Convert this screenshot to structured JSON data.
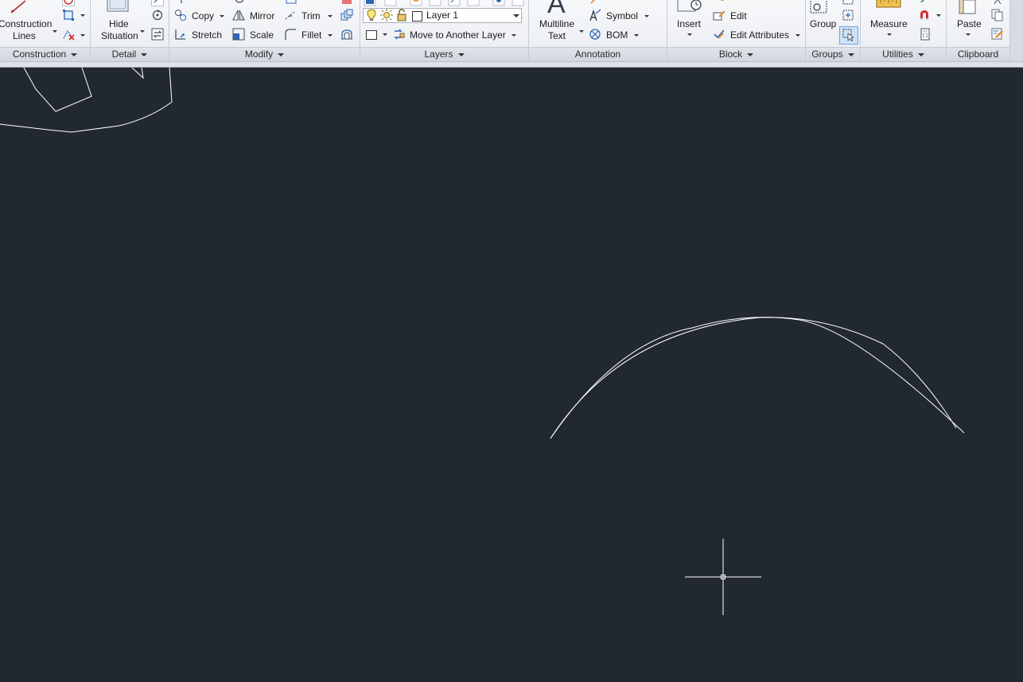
{
  "ribbon": {
    "panels": {
      "construction": "Construction",
      "detail": "Detail",
      "modify": "Modify",
      "layers": "Layers",
      "annotation": "Annotation",
      "block": "Block",
      "groups": "Groups",
      "utilities": "Utilities",
      "clipboard": "Clipboard"
    },
    "construction": {
      "lines_line1": "Construction",
      "lines_line2": "Lines"
    },
    "detail": {
      "hide_line1": "Hide",
      "hide_line2": "Situation"
    },
    "modify": {
      "copy": "Copy",
      "mirror": "Mirror",
      "trim": "Trim",
      "stretch": "Stretch",
      "scale": "Scale",
      "fillet": "Fillet"
    },
    "layers": {
      "current_layer": "Layer 1",
      "move_to_layer": "Move to Another Layer"
    },
    "annotation": {
      "multiline_line1": "Multiline",
      "multiline_line2": "Text",
      "symbol": "Symbol",
      "bom": "BOM"
    },
    "block": {
      "insert": "Insert",
      "edit": "Edit",
      "edit_attributes": "Edit Attributes"
    },
    "groups": {
      "group": "Group"
    },
    "utilities": {
      "measure": "Measure"
    },
    "clipboard": {
      "paste": "Paste"
    }
  },
  "colors": {
    "canvas_background": "#212830",
    "geometry_stroke": "#ffffff",
    "ribbon_background": "#eceff3",
    "selection_highlight": "#cde3f7"
  },
  "canvas": {
    "cursor": "crosshair-cursor"
  }
}
